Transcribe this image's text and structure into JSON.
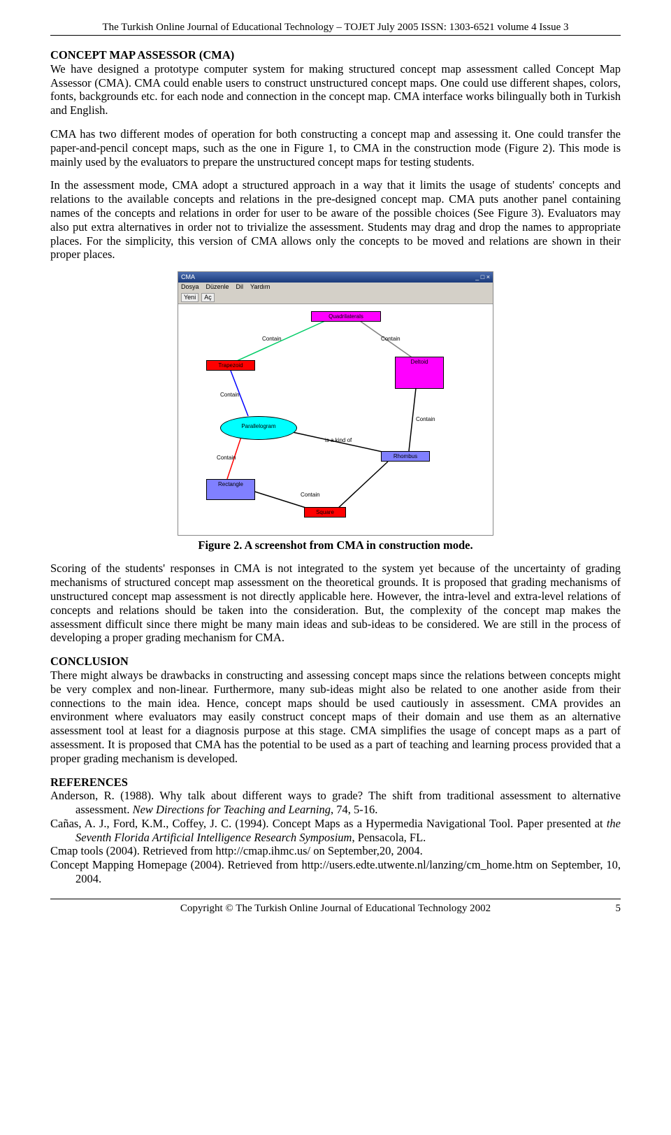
{
  "header": "The Turkish Online Journal of Educational Technology – TOJET July 2005 ISSN: 1303-6521 volume 4 Issue 3",
  "s1": {
    "title": "CONCEPT MAP ASSESSOR (CMA)",
    "p1": "We have designed a prototype computer system for making structured concept map assessment called Concept Map Assessor (CMA). CMA could enable users to construct unstructured concept maps. One could use different shapes, colors, fonts, backgrounds etc. for each node and connection in the concept map. CMA interface works bilingually both in Turkish and English.",
    "p2": "CMA has two different modes of operation for both constructing a concept map and assessing it. One could transfer the paper-and-pencil concept maps, such as the one in Figure 1, to CMA in the construction mode (Figure 2). This mode is mainly used by the evaluators to prepare the unstructured concept maps for testing students.",
    "p3": "In the assessment mode, CMA adopt a structured approach in a way that it limits the usage of students' concepts and relations  to the available concepts and relations in the pre-designed concept map. CMA puts another panel containing names of the concepts and relations in order for user to be aware of the possible choices (See Figure 3). Evaluators may also put extra alternatives in order not to trivialize the assessment. Students may drag and drop the names to appropriate places. For the simplicity, this version of CMA allows only the concepts to be moved and relations are shown in their proper places."
  },
  "fig": {
    "caption": "Figure 2. A screenshot from CMA in construction mode.",
    "title": "CMA",
    "winbuttons": "_ □ ×",
    "menu": {
      "m1": "Dosya",
      "m2": "Düzenle",
      "m3": "Dil",
      "m4": "Yardım"
    },
    "tool1": "Yeni",
    "tool2": "Aç",
    "nodes": {
      "root": "Quadrilaterals",
      "trap": "Trapezoid",
      "delt": "Deltoid",
      "para": "Parallelogram",
      "rhom": "Rhombus",
      "rect": "Rectangle",
      "sq": "Square"
    },
    "edges": {
      "e1": "Contain",
      "e2": "Contain",
      "e3": "Contain",
      "e4": "is a kind of",
      "e5": "Contain",
      "e6": "Contain",
      "e7": "Contain"
    }
  },
  "s2": {
    "p1": "Scoring of the students' responses in CMA is not integrated to the system yet because of the uncertainty of grading mechanisms of structured concept map assessment on the theoretical grounds. It is proposed that grading mechanisms of unstructured concept map assessment is not directly applicable here. However, the intra-level and extra-level relations of concepts and relations should be taken into the consideration. But, the complexity of the concept map makes the assessment difficult since there might be many main ideas and sub-ideas to be considered. We are still in the process of developing a proper grading mechanism for CMA."
  },
  "s3": {
    "title": "CONCLUSION",
    "p1": "There might always be drawbacks in constructing and assessing concept maps since the relations between concepts might be very complex and non-linear. Furthermore, many sub-ideas might also be related to one another aside from their connections to the main idea. Hence, concept maps should be used cautiously in assessment. CMA provides an environment where evaluators may easily construct concept maps of their domain and use them as an alternative assessment tool at least for a diagnosis purpose at this stage. CMA simplifies the usage of concept maps as a part of assessment. It is proposed that CMA has the potential to be used as a part of teaching and learning process provided that a proper grading mechanism is developed."
  },
  "refs": {
    "title": "REFERENCES",
    "r1a": "Anderson, R. (1988). Why talk about different ways to grade? The shift from traditional assessment to alternative assessment. ",
    "r1b": "New Directions for Teaching and Learning",
    "r1c": ", 74, 5-16.",
    "r2a": "Cañas, A. J., Ford, K.M., Coffey, J. C. (1994). Concept Maps as a Hypermedia Navigational Tool. Paper presented at ",
    "r2b": "the Seventh Florida Artificial Intelligence Research Symposium",
    "r2c": ", Pensacola, FL.",
    "r3": "Cmap tools (2004). Retrieved from http://cmap.ihmc.us/ on September,20, 2004.",
    "r4": "Concept Mapping Homepage (2004). Retrieved from http://users.edte.utwente.nl/lanzing/cm_home.htm on September, 10, 2004."
  },
  "footer": {
    "center": "Copyright © The Turkish Online Journal of Educational Technology 2002",
    "page": "5"
  }
}
